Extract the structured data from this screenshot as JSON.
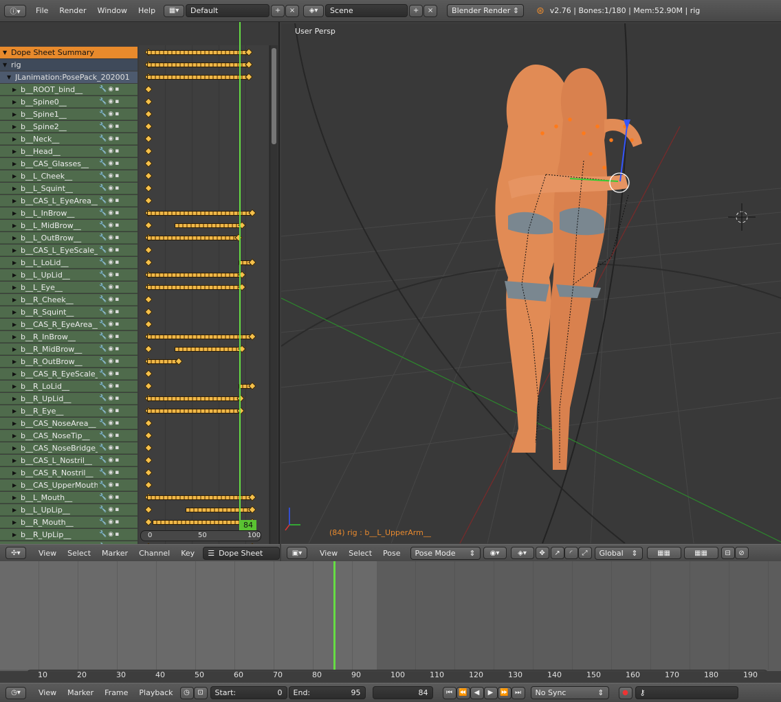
{
  "topbar": {
    "menus": [
      "File",
      "Render",
      "Window",
      "Help"
    ],
    "layout": "Default",
    "scene": "Scene",
    "engine": "Blender Render",
    "stats": "v2.76 | Bones:1/180  | Mem:52.90M | rig"
  },
  "dopesheet": {
    "summary": "Dope Sheet Summary",
    "object": "rig",
    "action": "JLanimation:PosePack_202001",
    "channels": [
      "b__ROOT_bind__",
      "b__Spine0__",
      "b__Spine1__",
      "b__Spine2__",
      "b__Neck__",
      "b__Head__",
      "b__CAS_Glasses__",
      "b__L_Cheek__",
      "b__L_Squint__",
      "b__CAS_L_EyeArea__",
      "b__L_InBrow__",
      "b__L_MidBrow__",
      "b__L_OutBrow__",
      "b__CAS_L_EyeScale__",
      "b__L_LoLid__",
      "b__L_UpLid__",
      "b__L_Eye__",
      "b__R_Cheek__",
      "b__R_Squint__",
      "b__CAS_R_EyeArea__",
      "b__R_InBrow__",
      "b__R_MidBrow__",
      "b__R_OutBrow__",
      "b__CAS_R_EyeScale__",
      "b__R_LoLid__",
      "b__R_UpLid__",
      "b__R_Eye__",
      "b__CAS_NoseArea__",
      "b__CAS_NoseTip__",
      "b__CAS_NoseBridge__",
      "b__CAS_L_Nostril__",
      "b__CAS_R_Nostril__",
      "b__CAS_UpperMouthArea__",
      "b__L_Mouth__",
      "b__L_UpLip__",
      "b__R_Mouth__",
      "b__R_UpLip__",
      "b__UpLip__"
    ],
    "ruler": [
      "0",
      "50",
      "100"
    ],
    "current_frame": "84",
    "header": [
      "View",
      "Select",
      "Marker",
      "Channel",
      "Key"
    ],
    "mode": "Dope Sheet"
  },
  "viewport": {
    "label": "User Persp",
    "selection": "(84) rig : b__L_UpperArm__",
    "header": [
      "View",
      "Select",
      "Pose"
    ],
    "mode": "Pose Mode",
    "orientation": "Global"
  },
  "timeline": {
    "ticks": [
      "10",
      "20",
      "30",
      "40",
      "50",
      "60",
      "70",
      "80",
      "90",
      "100",
      "110",
      "120",
      "130",
      "140",
      "150",
      "160",
      "170",
      "180",
      "190"
    ],
    "menus": [
      "View",
      "Marker",
      "Frame",
      "Playback"
    ],
    "start_label": "Start:",
    "start": "0",
    "end_label": "End:",
    "end": "95",
    "frame": "84",
    "sync": "No Sync"
  },
  "colors": {
    "accent": "#e98a2e",
    "playhead": "#66dd44",
    "bone_row": "#4f6b4c"
  }
}
